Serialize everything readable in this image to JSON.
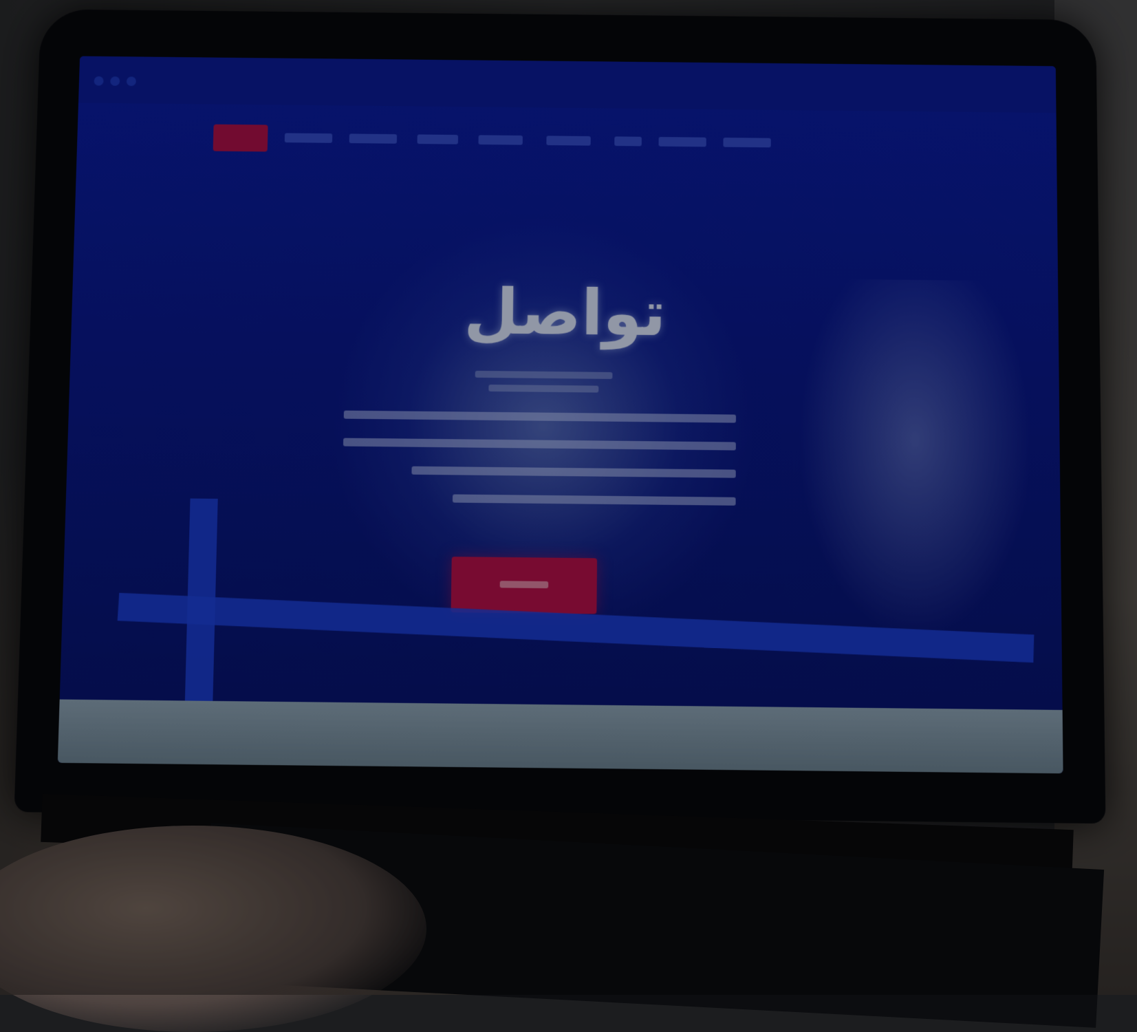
{
  "photo": {
    "subject": "laptop-with-website",
    "hero_title": "تواصل",
    "colors": {
      "screen_blue": "#0b1fa8",
      "accent_red": "#b8124c",
      "background_dark": "#1c1d1f"
    }
  }
}
